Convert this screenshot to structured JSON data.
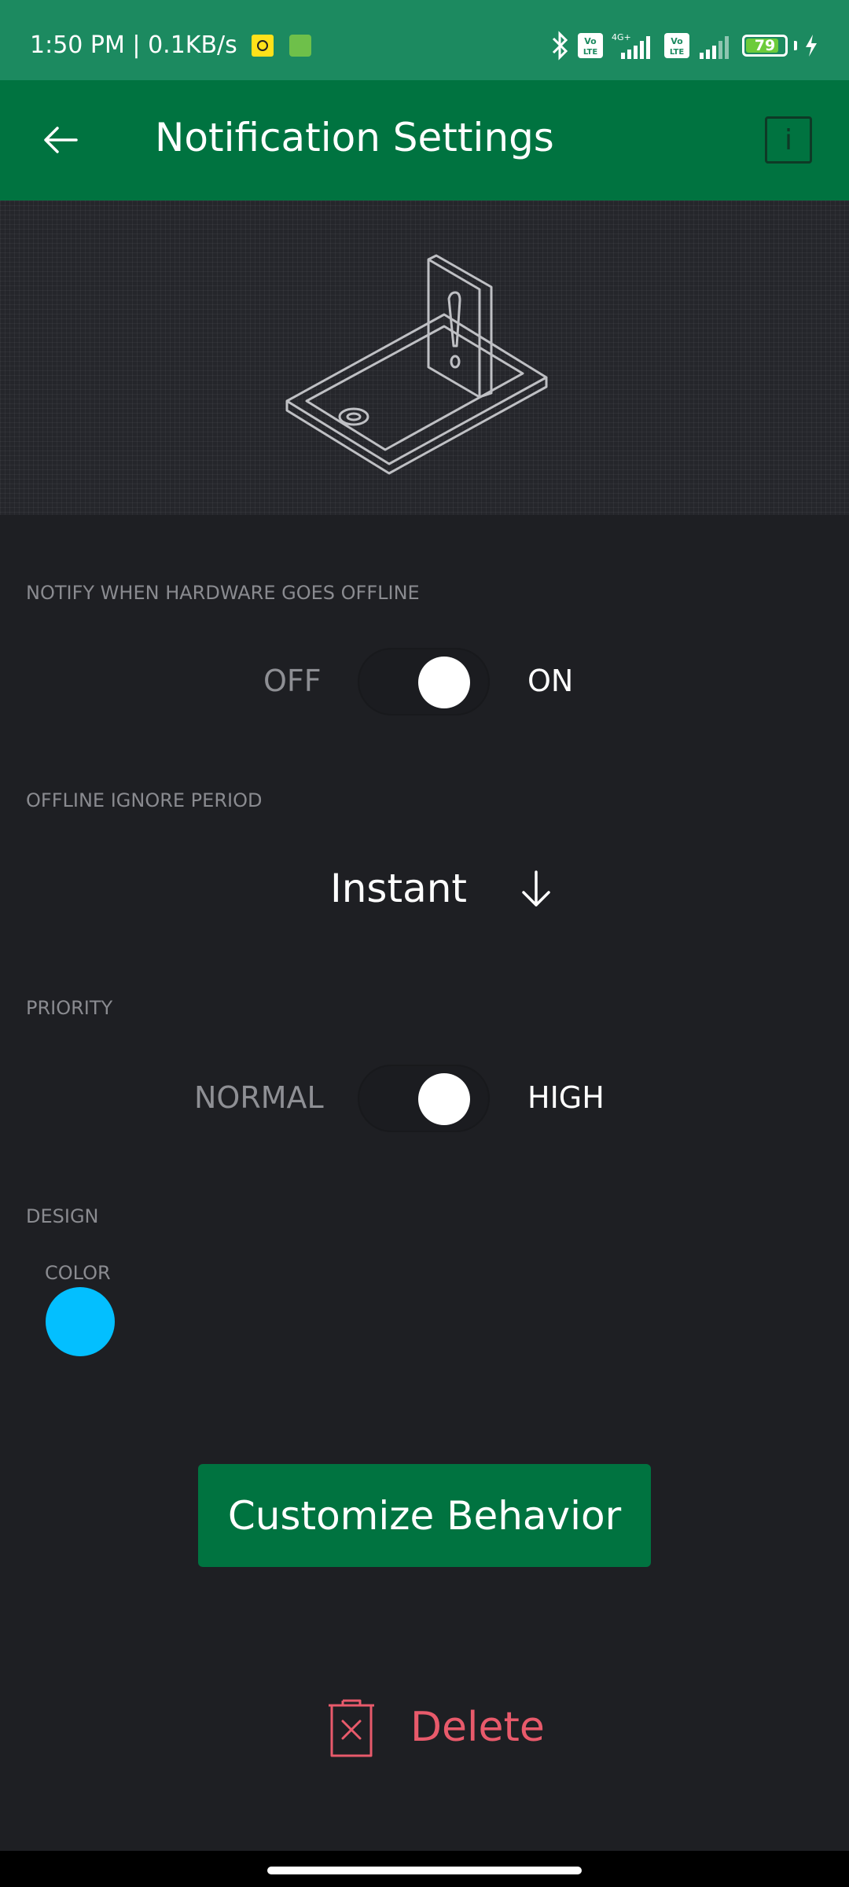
{
  "status_bar": {
    "time": "1:50 PM",
    "speed": "0.1KB/s",
    "battery": "79",
    "network_1": "VoLTE",
    "network_2": "4G+"
  },
  "app_bar": {
    "title": "Notification Settings",
    "info_label": "i"
  },
  "offline_notify": {
    "section_label": "NOTIFY WHEN HARDWARE GOES OFFLINE",
    "off_label": "OFF",
    "on_label": "ON",
    "enabled": true
  },
  "ignore_period": {
    "section_label": "OFFLINE IGNORE PERIOD",
    "value": "Instant"
  },
  "priority": {
    "section_label": "PRIORITY",
    "low_label": "NORMAL",
    "high_label": "HIGH",
    "value": "HIGH"
  },
  "design": {
    "section_label": "DESIGN",
    "color_label": "COLOR",
    "color_value": "#03bfff"
  },
  "actions": {
    "customize_label": "Customize Behavior",
    "delete_label": "Delete"
  },
  "colors": {
    "status_bar": "#1c8a60",
    "app_bar": "#007340",
    "background": "#1e1f23",
    "delete": "#e85a6b"
  }
}
